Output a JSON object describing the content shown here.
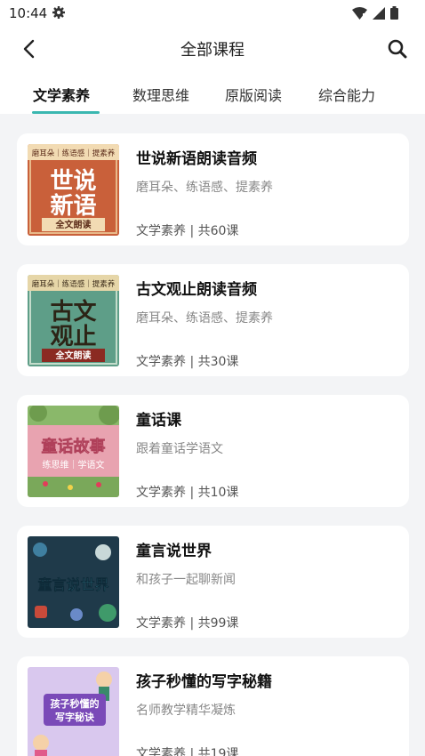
{
  "status_bar": {
    "time": "10:44"
  },
  "header": {
    "title": "全部课程"
  },
  "tabs": [
    {
      "label": "文学素养",
      "active": true
    },
    {
      "label": "数理思维",
      "active": false
    },
    {
      "label": "原版阅读",
      "active": false
    },
    {
      "label": "综合能力",
      "active": false
    }
  ],
  "courses": [
    {
      "title": "世说新语朗读音频",
      "subtitle": "磨耳朵、练语感、提素养",
      "meta": "文学素养 | 共60课",
      "cover": {
        "top_banner": "磨耳朵｜练语感｜提素养",
        "line1": "世说",
        "line2": "新语",
        "ribbon": "全文朗读"
      }
    },
    {
      "title": "古文观止朗读音频",
      "subtitle": "磨耳朵、练语感、提素养",
      "meta": "文学素养 | 共30课",
      "cover": {
        "top_banner": "磨耳朵｜练语感｜提素养",
        "line1": "古文",
        "line2": "观止",
        "ribbon": "全文朗读"
      }
    },
    {
      "title": "童话课",
      "subtitle": "跟着童话学语文",
      "meta": "文学素养 | 共10课",
      "cover": {
        "line1": "童话故事",
        "line2": "练思维｜学语文"
      }
    },
    {
      "title": "童言说世界",
      "subtitle": "和孩子一起聊新闻",
      "meta": "文学素养 | 共99课",
      "cover": {
        "line1": "童言说世界"
      }
    },
    {
      "title": "孩子秒懂的写字秘籍",
      "subtitle": "名师教学精华凝炼",
      "meta": "文学素养 | 共19课",
      "cover": {
        "line1": "孩子秒懂的",
        "line2": "写字秘诀"
      }
    }
  ],
  "icons": {
    "back": "chevron-left-icon",
    "search": "search-icon",
    "status": [
      "gear-icon",
      "wifi-icon",
      "signal-icon",
      "battery-icon"
    ]
  },
  "colors": {
    "accent": "#3ab7b0",
    "background": "#f3f4f6",
    "card": "#ffffff"
  }
}
